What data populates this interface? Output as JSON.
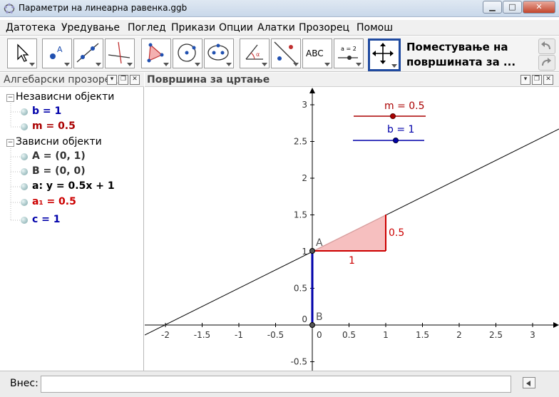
{
  "window": {
    "title": "Параметри на линеарна равенка.ggb",
    "minimize_icon": "minimize-icon",
    "maximize_icon": "maximize-icon",
    "close_icon": "close-icon"
  },
  "menu": [
    "Датотека",
    "Уредување",
    "Поглед",
    "Прикази",
    "Опции",
    "Алатки",
    "Прозорец",
    "Помош"
  ],
  "toolbar": {
    "tools": [
      "move",
      "point",
      "line",
      "perpendicular-line",
      "polygon",
      "circle",
      "conic",
      "angle",
      "reflect",
      "text",
      "slider",
      "move-graphics-view"
    ],
    "text_tool_label": "ABC",
    "slider_tool_label": "a = 2",
    "help_text_line1": "Поместување на",
    "help_text_line2": "површината за ..."
  },
  "algebra": {
    "title": "Алгебарски прозорец",
    "groups": [
      {
        "label": "Независни објекти",
        "items": [
          {
            "text": "b = 1",
            "color": "#0000aa"
          },
          {
            "text": "m = 0.5",
            "color": "#aa0000"
          }
        ]
      },
      {
        "label": "Зависни објекти",
        "items": [
          {
            "text": "A = (0, 1)",
            "color": "#333333"
          },
          {
            "text": "B = (0, 0)",
            "color": "#333333"
          },
          {
            "text": "a: y = 0.5x + 1",
            "color": "#000000"
          },
          {
            "text": "a₁ = 0.5",
            "color": "#cc0000"
          },
          {
            "text": "c = 1",
            "color": "#0000aa"
          }
        ]
      }
    ]
  },
  "graphics": {
    "title": "Површина за цртање",
    "x_ticks": [
      "-2",
      "-1.5",
      "-1",
      "-0.5",
      "0",
      "0.5",
      "1",
      "1.5",
      "2",
      "2.5",
      "3"
    ],
    "y_ticks": [
      "-0.5",
      "0",
      "0.5",
      "1",
      "1.5",
      "2",
      "2.5",
      "3"
    ],
    "slider_m_label": "m = 0.5",
    "slider_b_label": "b = 1",
    "slope_run_label": "1",
    "slope_rise_label": "0.5",
    "point_A_label": "A",
    "point_B_label": "B",
    "colors": {
      "slope": "#cc0000",
      "intercept": "#0000aa",
      "line": "#000000"
    }
  },
  "input": {
    "label": "Внес:",
    "value": "",
    "keyboard_icon": "keyboard-icon"
  }
}
